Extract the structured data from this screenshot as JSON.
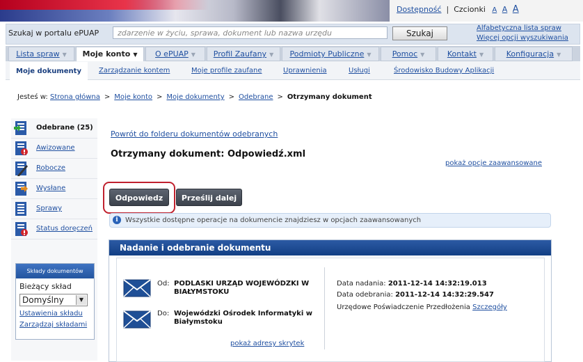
{
  "header": {
    "accessibility_link": "Dostępność",
    "font_label": "Czcionki",
    "font_sizes": [
      "A",
      "A",
      "A"
    ]
  },
  "search": {
    "label": "Szukaj w portalu ePUAP",
    "placeholder": "zdarzenie w życiu, sprawa, dokument lub nazwa urzędu",
    "button": "Szukaj",
    "alphabetical_link": "Alfabetyczna lista spraw",
    "more_options_link": "Więcej opcji wyszukiwania"
  },
  "main_nav": {
    "tabs": [
      {
        "label": "Lista spraw"
      },
      {
        "label": "Moje konto"
      },
      {
        "label": "O ePUAP"
      },
      {
        "label": "Profil Zaufany"
      },
      {
        "label": "Podmioty Publiczne"
      },
      {
        "label": "Pomoc"
      },
      {
        "label": "Kontakt"
      },
      {
        "label": "Konfiguracja"
      }
    ],
    "active": "Moje konto"
  },
  "sub_nav": {
    "items": [
      {
        "label": "Moje dokumenty"
      },
      {
        "label": "Zarządzanie kontem"
      },
      {
        "label": "Moje profile zaufane"
      },
      {
        "label": "Uprawnienia"
      },
      {
        "label": "Usługi"
      },
      {
        "label": "Środowisko Budowy Aplikacji"
      }
    ],
    "active": "Moje dokumenty"
  },
  "breadcrumb": {
    "prefix": "Jesteś w:",
    "items": [
      "Strona główna",
      "Moje konto",
      "Moje dokumenty",
      "Odebrane"
    ],
    "current": "Otrzymany dokument",
    "separator": ">"
  },
  "sidebar": {
    "items": [
      {
        "label": "Odebrane (25)",
        "icon": "inbox-icon"
      },
      {
        "label": "Awizowane",
        "icon": "notice-icon"
      },
      {
        "label": "Robocze",
        "icon": "draft-icon"
      },
      {
        "label": "Wysłane",
        "icon": "sent-icon"
      },
      {
        "label": "Sprawy",
        "icon": "cases-icon"
      },
      {
        "label": "Status doręczeń",
        "icon": "delivery-status-icon"
      }
    ],
    "stores": {
      "header": "Składy dokumentów",
      "current_label": "Bieżący skład",
      "selected": "Domyślny",
      "settings_link": "Ustawienia składu",
      "manage_link": "Zarządzaj składami"
    }
  },
  "content": {
    "back_link": "Powrót do folderu dokumentów odebranych",
    "title": "Otrzymany dokument: Odpowiedź.xml",
    "advanced_link": "pokaż opcje zaawansowane",
    "buttons": {
      "reply": "Odpowiedz",
      "forward": "Prześlij dalej"
    },
    "info": "Wszystkie dostępne operacje na dokumencie znajdziesz w opcjach zaawansowanych",
    "panel": {
      "title": "Nadanie i odebranie dokumentu",
      "from_label": "Od:",
      "from": "PODLASKI URZĄD WOJEWÓDZKI W BIAŁYMSTOKU",
      "to_label": "Do:",
      "to": "Wojewódzki Ośrodek Informatyki w Białymstoku",
      "show_boxes_link": "pokaż adresy skrytek",
      "sent_label": "Data nadania:",
      "sent": "2011-12-14 14:32:19.013",
      "received_label": "Data odebrania:",
      "received": "2011-12-14 14:32:29.547",
      "upo_label": "Urzędowe Poświadczenie Przedłożenia",
      "upo_link": "Szczegóły"
    }
  },
  "colors": {
    "accent": "#1f4fa0",
    "panel_header": "#1e4a93",
    "highlight": "#c0212e",
    "button": "#4a505a"
  }
}
